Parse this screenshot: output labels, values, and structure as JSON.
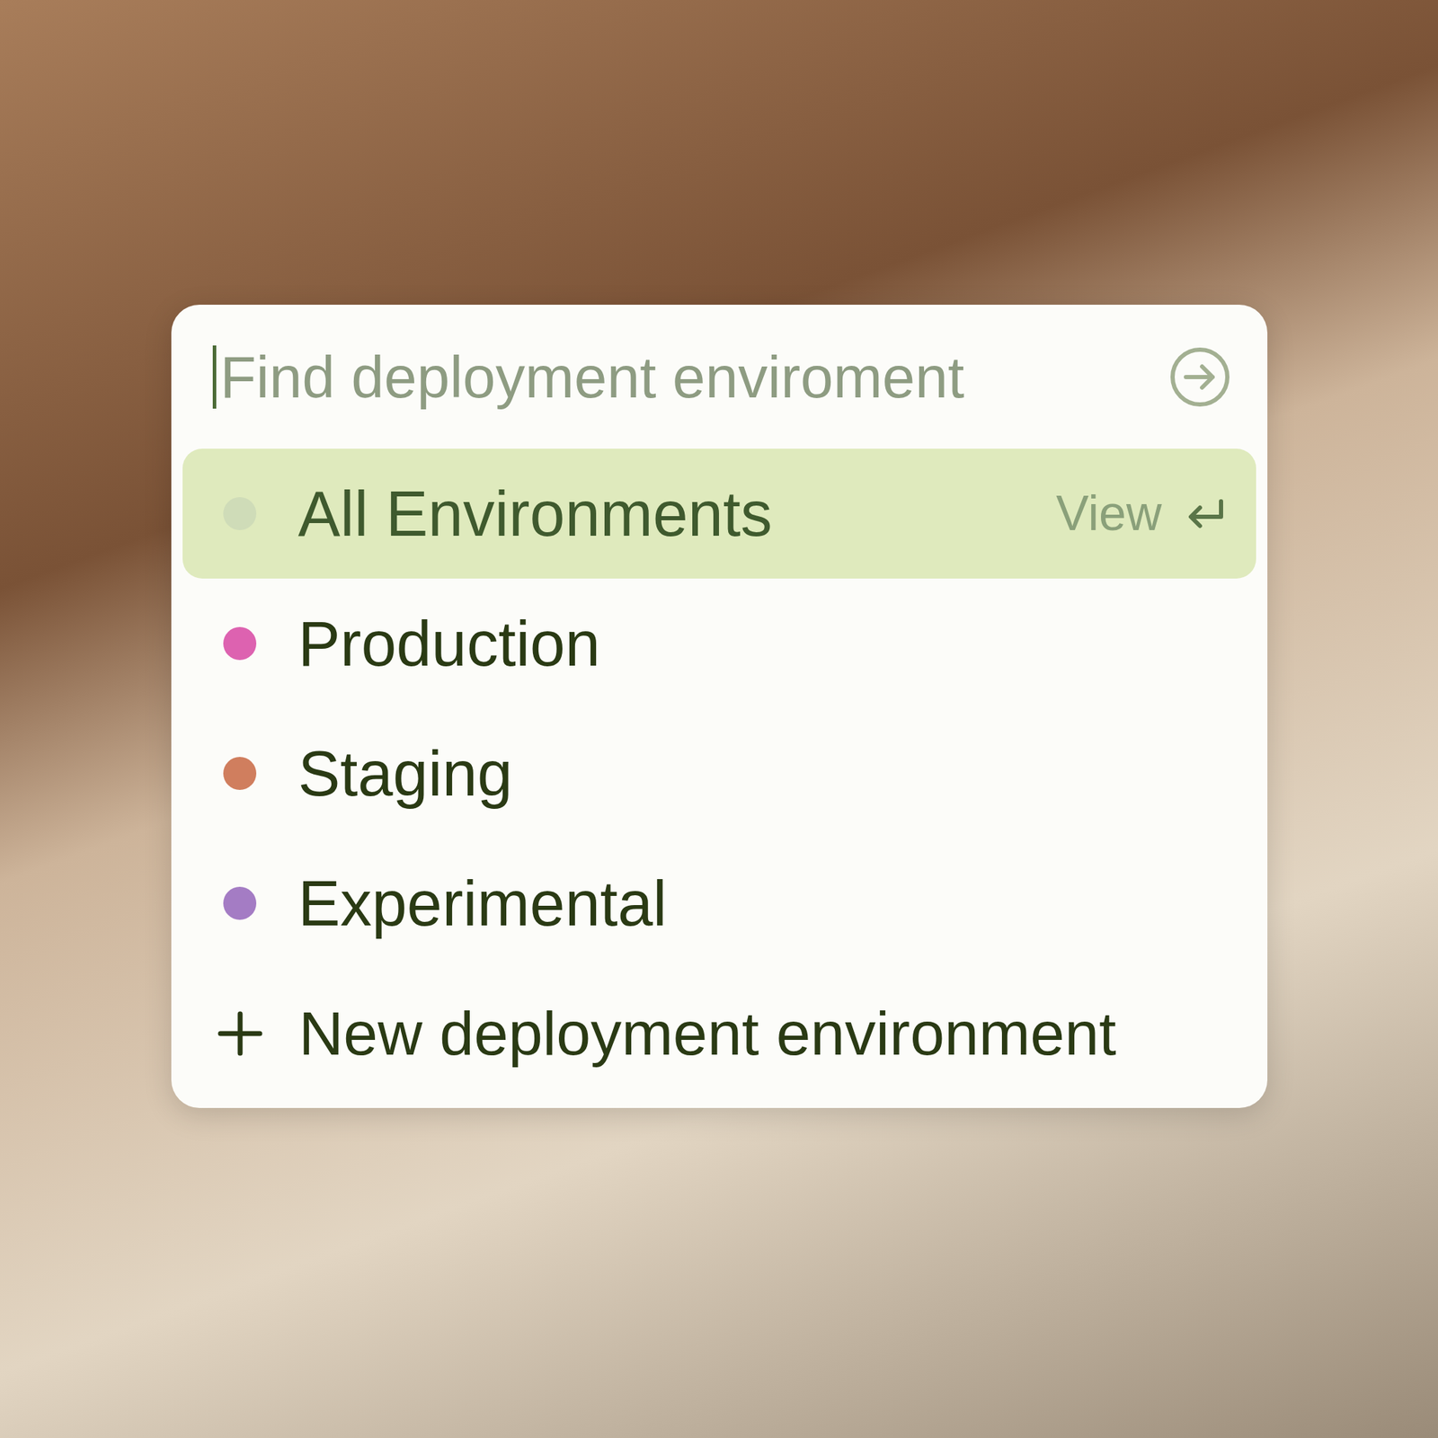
{
  "search": {
    "placeholder": "Find deployment enviroment"
  },
  "items": [
    {
      "label": "All Environments",
      "color": "#cfdcb8",
      "selected": true
    },
    {
      "label": "Production",
      "color": "#dd62b0",
      "selected": false
    },
    {
      "label": "Staging",
      "color": "#d07e5e",
      "selected": false
    },
    {
      "label": "Experimental",
      "color": "#a47cc4",
      "selected": false
    }
  ],
  "selected_hint": "View",
  "new_item": {
    "label": "New deployment environment"
  }
}
